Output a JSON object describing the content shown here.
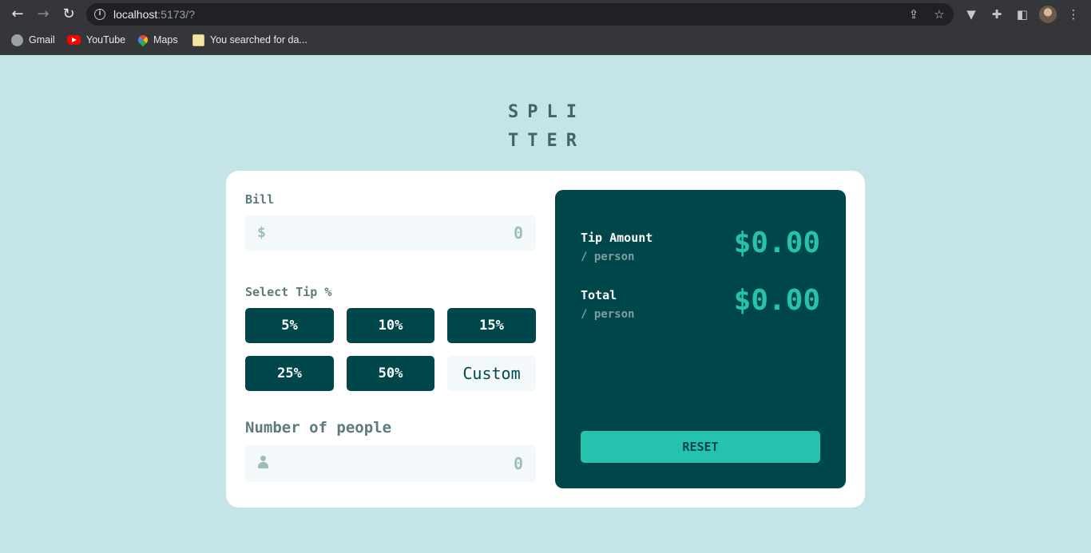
{
  "browser": {
    "url_host": "localhost",
    "url_rest": ":5173/?",
    "bookmarks": [
      {
        "label": "Gmail",
        "icon": "globe-icon"
      },
      {
        "label": "YouTube",
        "icon": "youtube-icon"
      },
      {
        "label": "Maps",
        "icon": "maps-icon"
      },
      {
        "label": "You searched for da...",
        "icon": "page-icon"
      }
    ]
  },
  "app": {
    "logo_line1": "SPLI",
    "logo_line2": "TTER",
    "bill": {
      "label": "Bill",
      "prefix": "$",
      "value": "0"
    },
    "tip": {
      "label": "Select Tip %",
      "options": [
        "5%",
        "10%",
        "15%",
        "25%",
        "50%"
      ],
      "custom": "Custom"
    },
    "people": {
      "label": "Number of people",
      "value": "0"
    },
    "results": {
      "tip_label": "Tip Amount",
      "tip_sub": "/ person",
      "tip_value": "$0.00",
      "total_label": "Total",
      "total_sub": "/ person",
      "total_value": "$0.00",
      "reset_label": "RESET"
    }
  },
  "colors": {
    "background": "#c5e4e7",
    "dark_cyan": "#00474b",
    "strong_cyan": "#26c2ae",
    "card": "#ffffff"
  }
}
